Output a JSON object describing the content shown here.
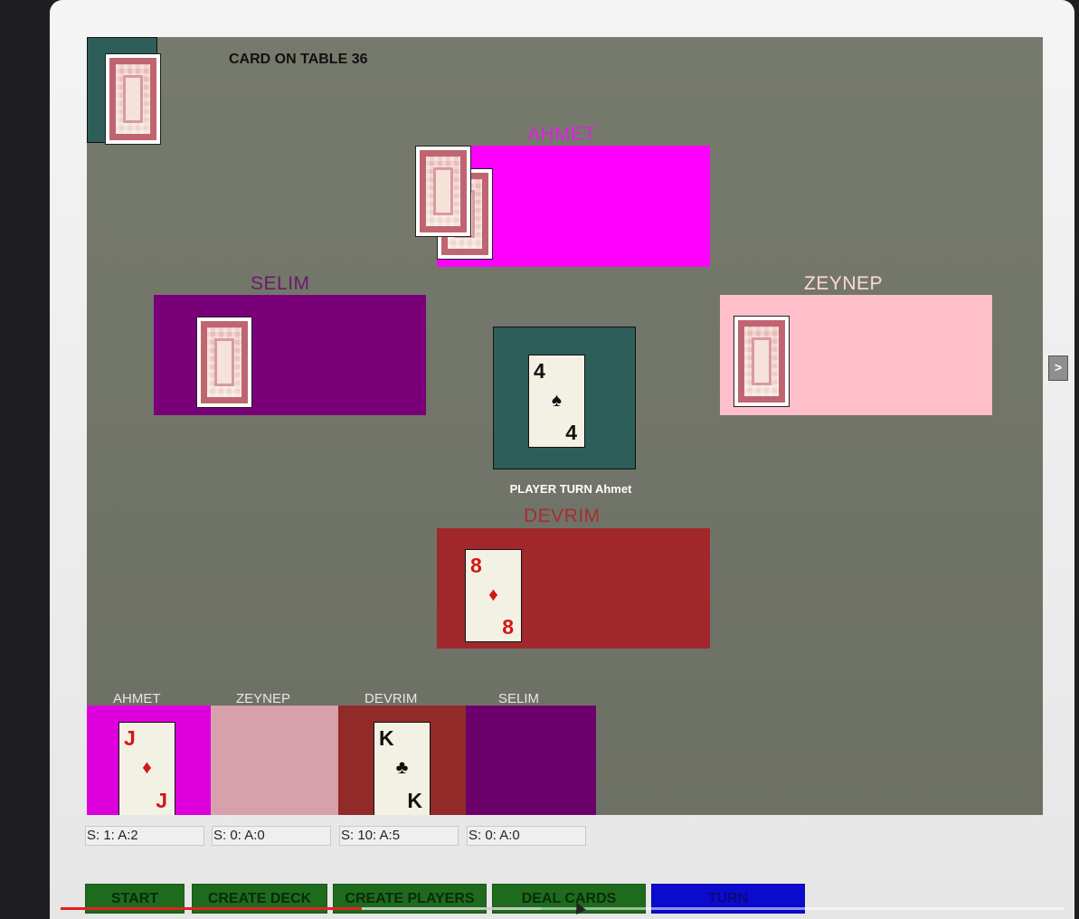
{
  "table": {
    "cards_on_table_label": "CARD ON TABLE 36",
    "player_turn_label": "PLAYER TURN Ahmet",
    "center_card": {
      "rank": "4",
      "suit": "♠",
      "color": "black"
    }
  },
  "players": {
    "ahmet": {
      "name": "AHMET",
      "color": "#ff00ff",
      "label_color": "#e020e0"
    },
    "selim": {
      "name": "SELIM",
      "color": "#7a007a",
      "label_color": "#6b1a6b"
    },
    "zeynep": {
      "name": "ZEYNEP",
      "color": "#ffc0cb",
      "label_color": "#ffd8de"
    },
    "devrim": {
      "name": "DEVRIM",
      "color": "#a0282c",
      "label_color": "#a72d30",
      "card": {
        "rank": "8",
        "suit": "♦",
        "color": "red"
      }
    }
  },
  "scoreboard": [
    {
      "name": "AHMET",
      "color": "#dd00dd",
      "score": "S: 1: A:2",
      "card": {
        "rank": "J",
        "suit": "♦",
        "color": "red"
      }
    },
    {
      "name": "ZEYNEP",
      "color": "#d8a0aa",
      "score": "S: 0: A:0",
      "card": null
    },
    {
      "name": "DEVRIM",
      "color": "#922a28",
      "score": "S: 10: A:5",
      "card": {
        "rank": "K",
        "suit": "♣",
        "color": "black"
      }
    },
    {
      "name": "SELIM",
      "color": "#6b006b",
      "score": "S: 0: A:0",
      "card": null
    }
  ],
  "buttons": {
    "start": "START",
    "create_deck": "CREATE DECK",
    "create_players": "CREATE PLAYERS",
    "deal_cards": "DEAL CARDS",
    "turn": "TURN"
  },
  "side_arrow": ">",
  "video_progress": 0.3
}
